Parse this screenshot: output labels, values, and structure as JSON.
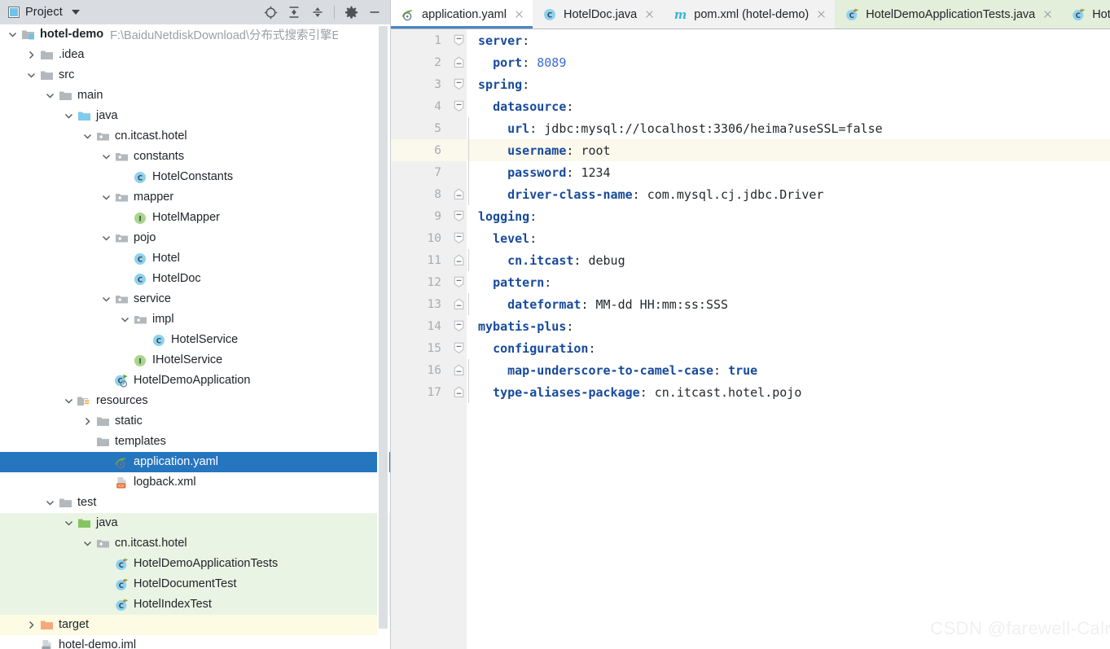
{
  "panel": {
    "title": "Project",
    "icon": "project-panel-icon",
    "dropdown_icon": "chevron-down-icon",
    "tools": [
      {
        "name": "locate-in-tree-icon",
        "label": ""
      },
      {
        "name": "expand-all-icon",
        "label": ""
      },
      {
        "name": "collapse-all-icon",
        "label": ""
      },
      {
        "name": "settings-gear-icon",
        "label": ""
      },
      {
        "name": "minimize-panel-icon",
        "label": ""
      }
    ]
  },
  "tree": [
    {
      "label": "hotel-demo",
      "path": "F:\\BaiduNetdiskDownload\\分布式搜索引擎ElasticSe",
      "indent": 0,
      "twisty": "expanded",
      "icon": "module-folder-icon",
      "bold": true,
      "bg": "none",
      "selected": false
    },
    {
      "label": ".idea",
      "path": "",
      "indent": 1,
      "twisty": "collapsed",
      "icon": "folder-icon",
      "bold": false,
      "bg": "none",
      "selected": false
    },
    {
      "label": "src",
      "path": "",
      "indent": 1,
      "twisty": "expanded",
      "icon": "folder-icon",
      "bold": false,
      "bg": "none",
      "selected": false
    },
    {
      "label": "main",
      "path": "",
      "indent": 2,
      "twisty": "expanded",
      "icon": "folder-icon",
      "bold": false,
      "bg": "none",
      "selected": false
    },
    {
      "label": "java",
      "path": "",
      "indent": 3,
      "twisty": "expanded",
      "icon": "source-root-folder-icon",
      "bold": false,
      "bg": "none",
      "selected": false
    },
    {
      "label": "cn.itcast.hotel",
      "path": "",
      "indent": 4,
      "twisty": "expanded",
      "icon": "package-icon",
      "bold": false,
      "bg": "none",
      "selected": false
    },
    {
      "label": "constants",
      "path": "",
      "indent": 5,
      "twisty": "expanded",
      "icon": "package-icon",
      "bold": false,
      "bg": "none",
      "selected": false
    },
    {
      "label": "HotelConstants",
      "path": "",
      "indent": 6,
      "twisty": "none",
      "icon": "java-class-icon",
      "bold": false,
      "bg": "none",
      "selected": false
    },
    {
      "label": "mapper",
      "path": "",
      "indent": 5,
      "twisty": "expanded",
      "icon": "package-icon",
      "bold": false,
      "bg": "none",
      "selected": false
    },
    {
      "label": "HotelMapper",
      "path": "",
      "indent": 6,
      "twisty": "none",
      "icon": "java-interface-icon",
      "bold": false,
      "bg": "none",
      "selected": false
    },
    {
      "label": "pojo",
      "path": "",
      "indent": 5,
      "twisty": "expanded",
      "icon": "package-icon",
      "bold": false,
      "bg": "none",
      "selected": false
    },
    {
      "label": "Hotel",
      "path": "",
      "indent": 6,
      "twisty": "none",
      "icon": "java-class-icon",
      "bold": false,
      "bg": "none",
      "selected": false
    },
    {
      "label": "HotelDoc",
      "path": "",
      "indent": 6,
      "twisty": "none",
      "icon": "java-class-icon",
      "bold": false,
      "bg": "none",
      "selected": false
    },
    {
      "label": "service",
      "path": "",
      "indent": 5,
      "twisty": "expanded",
      "icon": "package-icon",
      "bold": false,
      "bg": "none",
      "selected": false
    },
    {
      "label": "impl",
      "path": "",
      "indent": 6,
      "twisty": "expanded",
      "icon": "package-icon",
      "bold": false,
      "bg": "none",
      "selected": false
    },
    {
      "label": "HotelService",
      "path": "",
      "indent": 7,
      "twisty": "none",
      "icon": "java-class-icon",
      "bold": false,
      "bg": "none",
      "selected": false
    },
    {
      "label": "IHotelService",
      "path": "",
      "indent": 6,
      "twisty": "none",
      "icon": "java-interface-icon",
      "bold": false,
      "bg": "none",
      "selected": false
    },
    {
      "label": "HotelDemoApplication",
      "path": "",
      "indent": 5,
      "twisty": "none",
      "icon": "runnable-class-icon",
      "bold": false,
      "bg": "none",
      "selected": false
    },
    {
      "label": "resources",
      "path": "",
      "indent": 3,
      "twisty": "expanded",
      "icon": "resource-root-folder-icon",
      "bold": false,
      "bg": "none",
      "selected": false
    },
    {
      "label": "static",
      "path": "",
      "indent": 4,
      "twisty": "collapsed",
      "icon": "folder-icon",
      "bold": false,
      "bg": "none",
      "selected": false
    },
    {
      "label": "templates",
      "path": "",
      "indent": 4,
      "twisty": "none",
      "icon": "folder-icon",
      "bold": false,
      "bg": "none",
      "selected": false
    },
    {
      "label": "application.yaml",
      "path": "",
      "indent": 5,
      "twisty": "none",
      "icon": "spring-yaml-icon",
      "bold": false,
      "bg": "none",
      "selected": true
    },
    {
      "label": "logback.xml",
      "path": "",
      "indent": 5,
      "twisty": "none",
      "icon": "xml-file-icon",
      "bold": false,
      "bg": "none",
      "selected": false
    },
    {
      "label": "test",
      "path": "",
      "indent": 2,
      "twisty": "expanded",
      "icon": "folder-icon",
      "bold": false,
      "bg": "none",
      "selected": false
    },
    {
      "label": "java",
      "path": "",
      "indent": 3,
      "twisty": "expanded",
      "icon": "test-source-root-folder-icon",
      "bold": false,
      "bg": "green",
      "selected": false
    },
    {
      "label": "cn.itcast.hotel",
      "path": "",
      "indent": 4,
      "twisty": "expanded",
      "icon": "package-icon",
      "bold": false,
      "bg": "green",
      "selected": false
    },
    {
      "label": "HotelDemoApplicationTests",
      "path": "",
      "indent": 5,
      "twisty": "none",
      "icon": "test-class-icon",
      "bold": false,
      "bg": "green",
      "selected": false
    },
    {
      "label": "HotelDocumentTest",
      "path": "",
      "indent": 5,
      "twisty": "none",
      "icon": "test-class-icon",
      "bold": false,
      "bg": "green",
      "selected": false
    },
    {
      "label": "HotelIndexTest",
      "path": "",
      "indent": 5,
      "twisty": "none",
      "icon": "test-class-icon",
      "bold": false,
      "bg": "green",
      "selected": false
    },
    {
      "label": "target",
      "path": "",
      "indent": 1,
      "twisty": "collapsed",
      "icon": "excluded-folder-icon",
      "bold": false,
      "bg": "yellow",
      "selected": false
    },
    {
      "label": "hotel-demo.iml",
      "path": "",
      "indent": 1,
      "twisty": "none",
      "icon": "iml-file-icon",
      "bold": false,
      "bg": "none",
      "selected": false
    }
  ],
  "tabs": [
    {
      "label": "application.yaml",
      "icon": "spring-yaml-icon",
      "active": true,
      "test": false,
      "closeable": true
    },
    {
      "label": "HotelDoc.java",
      "icon": "java-class-icon",
      "active": false,
      "test": false,
      "closeable": true
    },
    {
      "label": "pom.xml (hotel-demo)",
      "icon": "maven-icon",
      "active": false,
      "test": false,
      "closeable": true
    },
    {
      "label": "HotelDemoApplicationTests.java",
      "icon": "test-class-icon",
      "active": false,
      "test": true,
      "closeable": true
    },
    {
      "label": "HotelIn",
      "icon": "test-class-icon",
      "active": false,
      "test": true,
      "closeable": false
    }
  ],
  "editor": {
    "highlighted_line": 6,
    "lines": [
      {
        "num": 1,
        "fold": "start",
        "guides": 0,
        "indent": "",
        "tokens": [
          {
            "t": "server",
            "c": "k"
          },
          {
            "t": ":",
            "c": "v"
          }
        ]
      },
      {
        "num": 2,
        "fold": "end",
        "guides": 0,
        "indent": "  ",
        "tokens": [
          {
            "t": "port",
            "c": "k"
          },
          {
            "t": ": ",
            "c": "v"
          },
          {
            "t": "8089",
            "c": "n"
          }
        ]
      },
      {
        "num": 3,
        "fold": "start",
        "guides": 0,
        "indent": "",
        "tokens": [
          {
            "t": "spring",
            "c": "k"
          },
          {
            "t": ":",
            "c": "v"
          }
        ]
      },
      {
        "num": 4,
        "fold": "start",
        "guides": 0,
        "indent": "  ",
        "tokens": [
          {
            "t": "datasource",
            "c": "k"
          },
          {
            "t": ":",
            "c": "v"
          }
        ]
      },
      {
        "num": 5,
        "fold": "none",
        "guides": 1,
        "indent": "    ",
        "tokens": [
          {
            "t": "url",
            "c": "k"
          },
          {
            "t": ": ",
            "c": "v"
          },
          {
            "t": "jdbc:mysql://localhost:3306/heima?useSSL=false",
            "c": "v"
          }
        ]
      },
      {
        "num": 6,
        "fold": "none",
        "guides": 1,
        "indent": "    ",
        "tokens": [
          {
            "t": "username",
            "c": "k"
          },
          {
            "t": ": ",
            "c": "v"
          },
          {
            "t": "root",
            "c": "v"
          }
        ]
      },
      {
        "num": 7,
        "fold": "none",
        "guides": 1,
        "indent": "    ",
        "tokens": [
          {
            "t": "password",
            "c": "k"
          },
          {
            "t": ": ",
            "c": "v"
          },
          {
            "t": "1234",
            "c": "v"
          }
        ]
      },
      {
        "num": 8,
        "fold": "end",
        "guides": 1,
        "indent": "    ",
        "tokens": [
          {
            "t": "driver-class-name",
            "c": "k"
          },
          {
            "t": ": ",
            "c": "v"
          },
          {
            "t": "com.mysql.cj.jdbc.Driver",
            "c": "v"
          }
        ]
      },
      {
        "num": 9,
        "fold": "start",
        "guides": 0,
        "indent": "",
        "tokens": [
          {
            "t": "logging",
            "c": "k"
          },
          {
            "t": ":",
            "c": "v"
          }
        ]
      },
      {
        "num": 10,
        "fold": "start",
        "guides": 0,
        "indent": "  ",
        "tokens": [
          {
            "t": "level",
            "c": "k"
          },
          {
            "t": ":",
            "c": "v"
          }
        ]
      },
      {
        "num": 11,
        "fold": "end",
        "guides": 1,
        "indent": "    ",
        "tokens": [
          {
            "t": "cn.itcast",
            "c": "k"
          },
          {
            "t": ": ",
            "c": "v"
          },
          {
            "t": "debug",
            "c": "v"
          }
        ]
      },
      {
        "num": 12,
        "fold": "start",
        "guides": 0,
        "indent": "  ",
        "tokens": [
          {
            "t": "pattern",
            "c": "k"
          },
          {
            "t": ":",
            "c": "v"
          }
        ]
      },
      {
        "num": 13,
        "fold": "end",
        "guides": 1,
        "indent": "    ",
        "tokens": [
          {
            "t": "dateformat",
            "c": "k"
          },
          {
            "t": ": ",
            "c": "v"
          },
          {
            "t": "MM-dd HH:mm:ss:SSS",
            "c": "v"
          }
        ]
      },
      {
        "num": 14,
        "fold": "start",
        "guides": 0,
        "indent": "",
        "tokens": [
          {
            "t": "mybatis-plus",
            "c": "k"
          },
          {
            "t": ":",
            "c": "v"
          }
        ]
      },
      {
        "num": 15,
        "fold": "start",
        "guides": 0,
        "indent": "  ",
        "tokens": [
          {
            "t": "configuration",
            "c": "k"
          },
          {
            "t": ":",
            "c": "v"
          }
        ]
      },
      {
        "num": 16,
        "fold": "end",
        "guides": 1,
        "indent": "    ",
        "tokens": [
          {
            "t": "map-underscore-to-camel-case",
            "c": "k"
          },
          {
            "t": ": ",
            "c": "v"
          },
          {
            "t": "true",
            "c": "b"
          }
        ]
      },
      {
        "num": 17,
        "fold": "end",
        "guides": 1,
        "indent": "  ",
        "tokens": [
          {
            "t": "type-aliases-package",
            "c": "k"
          },
          {
            "t": ": ",
            "c": "v"
          },
          {
            "t": "cn.itcast.hotel.pojo",
            "c": "v"
          }
        ]
      }
    ]
  },
  "watermark": "CSDN @farewell-Calm",
  "colors": {
    "panel_header_bg": "#d9dde2",
    "selection_blue": "#2675bf",
    "test_green_bg": "#eaf4e4",
    "excluded_yellow_bg": "#fdfbe3",
    "yaml_key": "#174a9c",
    "yaml_number": "#3b6bd6",
    "gutter_bg": "#f0f0f0",
    "caret_line_bg": "#fbf8ec",
    "active_tab_underline": "#4a85c7"
  }
}
